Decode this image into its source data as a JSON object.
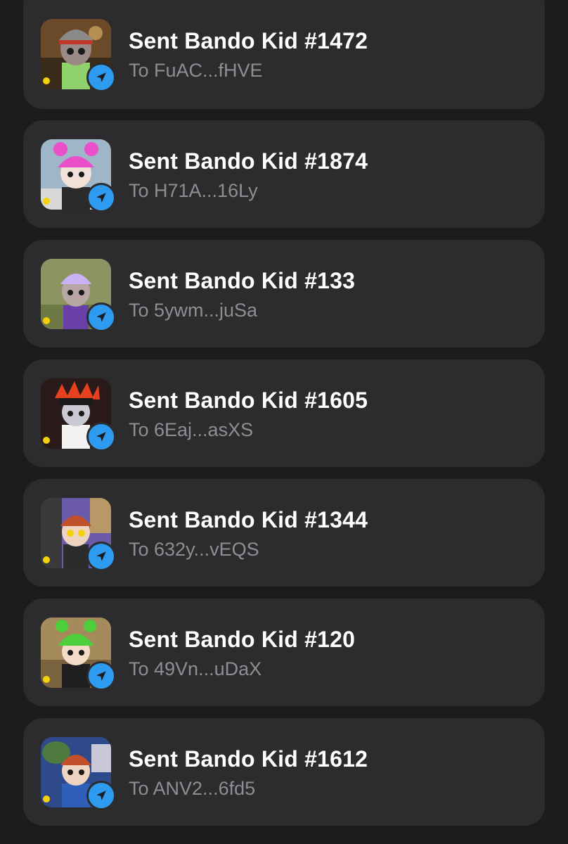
{
  "activity": {
    "items": [
      {
        "title": "Sent Bando Kid #1472",
        "subtitle": "To FuAC...fHVE",
        "thumb_bg": "#6b4a2a",
        "hair": "#8a8a8a",
        "accent": "#c0392b"
      },
      {
        "title": "Sent Bando Kid #1874",
        "subtitle": "To H71A...16Ly",
        "thumb_bg": "#9fb6c9",
        "hair": "#e84fc9",
        "accent": "#2b2b2b"
      },
      {
        "title": "Sent Bando Kid #133",
        "subtitle": "To 5ywm...juSa",
        "thumb_bg": "#8d9463",
        "hair": "#c9b3f5",
        "accent": "#6a3fa8"
      },
      {
        "title": "Sent Bando Kid #1605",
        "subtitle": "To 6Eaj...asXS",
        "thumb_bg": "#2a1a1a",
        "hair": "#e8411f",
        "accent": "#f2f2f2"
      },
      {
        "title": "Sent Bando Kid #1344",
        "subtitle": "To 632y...vEQS",
        "thumb_bg": "#6a5aa8",
        "hair": "#c2502b",
        "accent": "#2b2b2b"
      },
      {
        "title": "Sent Bando Kid #120",
        "subtitle": "To 49Vn...uDaX",
        "thumb_bg": "#a58a5c",
        "hair": "#4ccf3a",
        "accent": "#1f1f1f"
      },
      {
        "title": "Sent Bando Kid #1612",
        "subtitle": "To ANV2...6fd5",
        "thumb_bg": "#4f7a3f",
        "hair": "#c2502b",
        "accent": "#2f5fb8"
      }
    ],
    "badge_color": "#2d9cf0",
    "badge_icon": "send-arrow-icon",
    "title_color": "#ffffff",
    "subtitle_color": "#8e8e93"
  }
}
